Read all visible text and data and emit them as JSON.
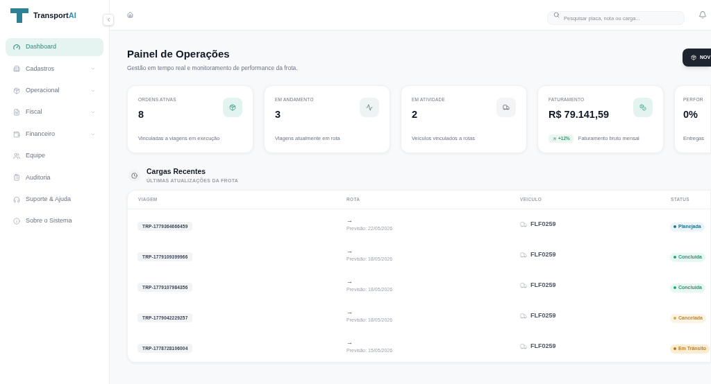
{
  "sidebar": {
    "logo": {
      "name": "Transport",
      "accent": "AI"
    },
    "items": [
      {
        "label": "Dashboard",
        "selected": true,
        "expandable": false
      },
      {
        "label": "Cadastros",
        "selected": false,
        "expandable": true
      },
      {
        "label": "Operacional",
        "selected": false,
        "expandable": true
      },
      {
        "label": "Fiscal",
        "selected": false,
        "expandable": true
      },
      {
        "label": "Financeiro",
        "selected": false,
        "expandable": true
      },
      {
        "label": "Equipe",
        "selected": false,
        "expandable": false
      },
      {
        "label": "Auditoria",
        "selected": false,
        "expandable": false
      },
      {
        "label": "Suporte & Ajuda",
        "selected": false,
        "expandable": false
      },
      {
        "label": "Sobre o Sistema",
        "selected": false,
        "expandable": false
      }
    ]
  },
  "header": {
    "search": {
      "placeholder": "Pesquisar placa, nota ou carga..."
    }
  },
  "page": {
    "title": "Painel de Operações",
    "subtitle": "Gestão em tempo real e monitoramento de performance da frota.",
    "action": "NOV"
  },
  "stats": [
    {
      "label": "ORDENS ATIVAS",
      "value": "8",
      "note": "Vinculadas a viagens em execução"
    },
    {
      "label": "EM ANDAMENTO",
      "value": "3",
      "note": "Viagens atualmente em rota"
    },
    {
      "label": "EM ATIVIDADE",
      "value": "2",
      "note": "Veículos vinculados a rotas"
    },
    {
      "label": "FATURAMENTO",
      "value": "R$ 79.141,59",
      "trend": "+12%",
      "note": "Faturamento bruto mensal"
    },
    {
      "label": "PERFOR",
      "value": "0%",
      "note": "Entregas"
    }
  ],
  "recent": {
    "title": "Cargas Recentes",
    "subtitle": "ÚLTIMAS ATUALIZAÇÕES DA FROTA",
    "table": {
      "columns": [
        "VIAGEM",
        "ROTA",
        "VEICULO",
        "STATUS"
      ],
      "rows": [
        {
          "trip": "TRP-1779364666459",
          "route": "→",
          "eta": "Previsão: 22/05/2026",
          "vehicle": "FLF0259",
          "status": {
            "label": "Planejada",
            "kind": "planned",
            "color": "#1f6f8b"
          }
        },
        {
          "trip": "TRP-1779109399966",
          "route": "→",
          "eta": "Previsão: 18/05/2026",
          "vehicle": "FLF0259",
          "status": {
            "label": "Concluída",
            "kind": "done",
            "color": "#1aa37a"
          }
        },
        {
          "trip": "TRP-1779107984356",
          "route": "→",
          "eta": "Previsão: 18/05/2026",
          "vehicle": "FLF0259",
          "status": {
            "label": "Concluída",
            "kind": "done",
            "color": "#1aa37a"
          }
        },
        {
          "trip": "TRP-1779042229257",
          "route": "→",
          "eta": "Previsão: 18/05/2026",
          "vehicle": "FLF0259",
          "status": {
            "label": "Cancelada",
            "kind": "cancelled",
            "color": "#d9a54a"
          }
        },
        {
          "trip": "TRP-1778728106004",
          "route": "→",
          "eta": "Previsão: 15/05/2026",
          "vehicle": "FLF0259",
          "status": {
            "label": "Em Trânsito",
            "kind": "transit",
            "color": "#c0721a"
          }
        }
      ]
    }
  }
}
